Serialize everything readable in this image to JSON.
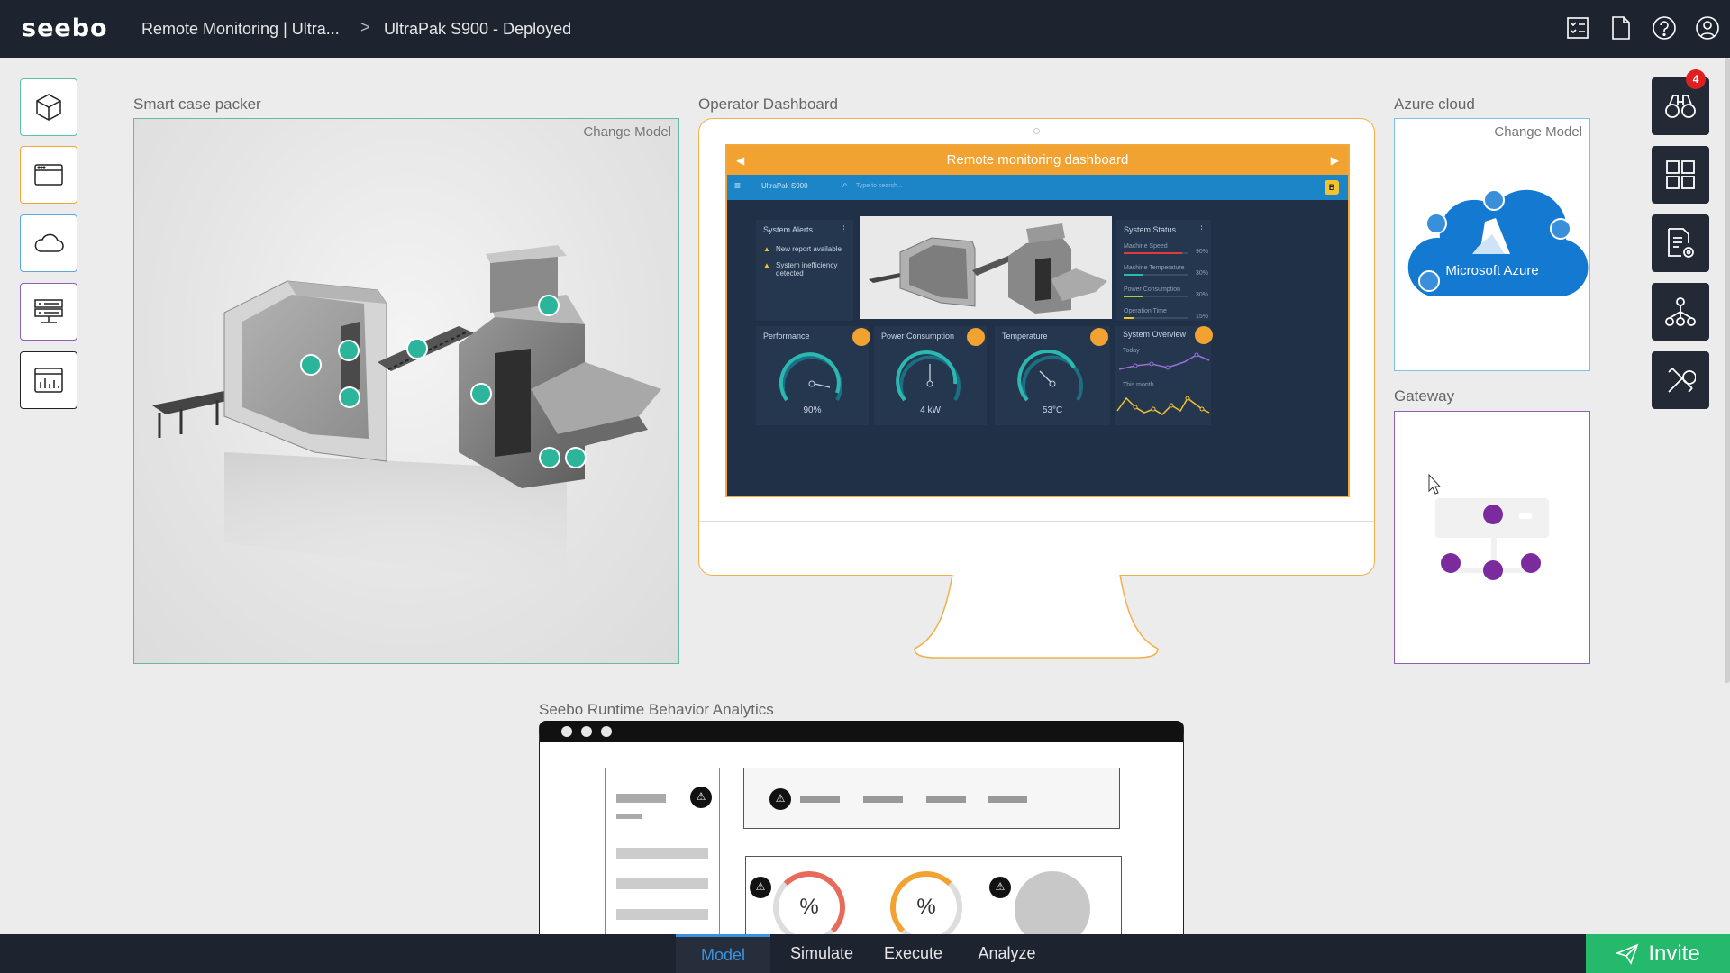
{
  "header": {
    "logo": "seebo",
    "breadcrumb_project": "Remote Monitoring | Ultra...",
    "breadcrumb_separator": ">",
    "breadcrumb_current": "UltraPak S900 - Deployed",
    "icons": [
      "checklist-icon",
      "document-icon",
      "help-icon",
      "user-icon"
    ]
  },
  "left_toolbar": [
    {
      "name": "3d-model-tool",
      "icon": "cube-icon",
      "color": "#5fbfa8"
    },
    {
      "name": "dashboard-tool",
      "icon": "browser-window-icon",
      "color": "#f0a63a"
    },
    {
      "name": "cloud-tool",
      "icon": "cloud-icon",
      "color": "#5aa8dd"
    },
    {
      "name": "gateway-tool",
      "icon": "gateway-icon",
      "color": "#8d5fb5"
    },
    {
      "name": "analytics-tool",
      "icon": "analytics-window-icon",
      "color": "#222222"
    }
  ],
  "panels": {
    "machine": {
      "title": "Smart case packer",
      "change_model": "Change Model"
    },
    "operator": {
      "title": "Operator Dashboard"
    },
    "azure": {
      "title": "Azure cloud",
      "change_model": "Change Model",
      "brand": "Microsoft Azure"
    },
    "gateway": {
      "title": "Gateway"
    },
    "analytics": {
      "title": "Seebo Runtime Behavior Analytics",
      "gauge_symbol": "%"
    }
  },
  "dashboard": {
    "title": "Remote monitoring dashboard",
    "nav_model": "UltraPak S900",
    "search_placeholder": "Type to search...",
    "nav_badge": "B",
    "alerts": {
      "title": "System Alerts",
      "items": [
        "New report available",
        "System inefficiency detected"
      ]
    },
    "status": {
      "title": "System Status",
      "rows": [
        {
          "label": "Machine Speed",
          "value": "90%",
          "level": 0.9,
          "color": "#e03a3a"
        },
        {
          "label": "Machine Temperature",
          "value": "30%",
          "level": 0.3,
          "color": "#2cb8b0"
        },
        {
          "label": "Power Consumption",
          "value": "30%",
          "level": 0.3,
          "color": "#9bd24a"
        },
        {
          "label": "Operation Time",
          "value": "15%",
          "level": 0.15,
          "color": "#f2c230"
        }
      ]
    },
    "gauges": [
      {
        "title": "Performance",
        "value": "90%"
      },
      {
        "title": "Power Consumption",
        "value": "4 kW"
      },
      {
        "title": "Temperature",
        "value": "53°C"
      }
    ],
    "overview": {
      "title": "System Overview",
      "today": "Today",
      "month": "This month"
    }
  },
  "right_toolbar": {
    "badge_count": "4",
    "items": [
      "binoculars-icon",
      "grid-icon",
      "report-settings-icon",
      "hierarchy-icon",
      "tools-icon"
    ]
  },
  "bottom_tabs": [
    {
      "label": "Model",
      "active": true
    },
    {
      "label": "Simulate",
      "active": false
    },
    {
      "label": "Execute",
      "active": false
    },
    {
      "label": "Analyze",
      "active": false
    }
  ],
  "invite_label": "Invite"
}
